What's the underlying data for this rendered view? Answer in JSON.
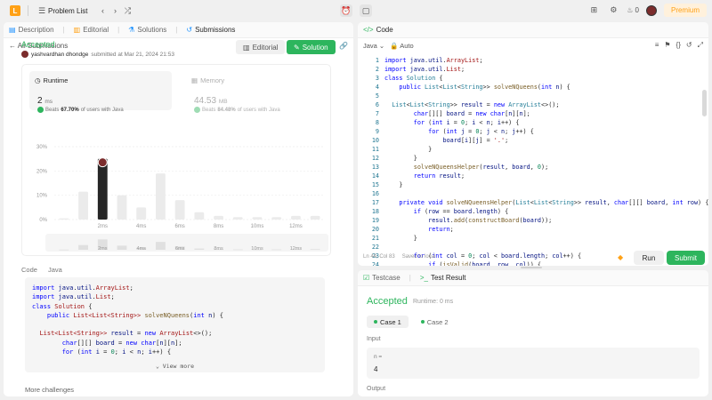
{
  "topbar": {
    "title": "Problem List",
    "fire_count": "0",
    "premium": "Premium"
  },
  "left": {
    "tabs": [
      {
        "label": "Description",
        "icon": "doc-icon"
      },
      {
        "label": "Editorial",
        "icon": "book-icon"
      },
      {
        "label": "Solutions",
        "icon": "flask-icon"
      },
      {
        "label": "Submissions",
        "icon": "history-icon"
      }
    ],
    "back_label": "All Submissions",
    "status": "Accepted",
    "author": "yashvardhan dhondge",
    "submitted_on": "submitted at Mar 21, 2024 21:53",
    "editorial_btn": "Editorial",
    "solution_btn": "Solution",
    "runtime": {
      "label": "Runtime",
      "value": "2",
      "unit": "ms",
      "beats_prefix": "Beats",
      "beats_pct": "67.70%",
      "beats_suffix": "of users with Java"
    },
    "memory": {
      "label": "Memory",
      "value": "44.53",
      "unit": "MB",
      "beats_prefix": "Beats",
      "beats_pct": "84.48%",
      "beats_suffix": "of users with Java"
    },
    "code_label": "Code",
    "code_lang": "Java",
    "code_lines": [
      "import java.util.ArrayList;",
      "import java.util.List;",
      "class Solution {",
      "    public List<List<String>> solveNQueens(int n) {",
      "",
      "  List<List<String>> result = new ArrayList<>();",
      "        char[][] board = new char[n][n];",
      "        for (int i = 0; i < n; i++) {"
    ],
    "view_more": "View more",
    "more_challenges": "More challenges"
  },
  "chart_data": {
    "type": "bar",
    "title": "",
    "xlabel": "",
    "ylabel": "",
    "y_ticks": [
      "30%",
      "20%",
      "10%",
      "0%"
    ],
    "ylim": [
      0,
      30
    ],
    "x_tick_labels": [
      "2ms",
      "4ms",
      "6ms",
      "8ms",
      "10ms",
      "12ms"
    ],
    "x_tick_positions": [
      2,
      4,
      6,
      8,
      10,
      12
    ],
    "bins": [
      0,
      1,
      2,
      3,
      4,
      5,
      6,
      7,
      8,
      9,
      10,
      11,
      12,
      13
    ],
    "values": [
      0.5,
      11.5,
      25,
      10,
      5,
      19,
      8,
      3,
      1.5,
      1,
      1,
      1,
      1.5,
      1.5
    ],
    "highlight_bin": 2,
    "grid": true,
    "minimap_x_tick_labels": [
      "2ms",
      "4ms",
      "6ms",
      "8ms",
      "10ms",
      "12ms"
    ]
  },
  "editor": {
    "header": "Code",
    "language": "Java",
    "mode": "Auto",
    "line_numbers": [
      "1",
      "2",
      "3",
      "4",
      "5",
      "6",
      "7",
      "8",
      "9",
      "10",
      "11",
      "12",
      "13",
      "14",
      "15",
      "16",
      "17",
      "18",
      "19",
      "20",
      "21",
      "22",
      "23",
      "24",
      "25",
      "26"
    ],
    "status": "Ln 44, Col 83",
    "saved": "Saved to local",
    "run": "Run",
    "submit": "Submit"
  },
  "result": {
    "tab_testcase": "Testcase",
    "tab_result": "Test Result",
    "status": "Accepted",
    "runtime": "Runtime: 0 ms",
    "cases": [
      "Case 1",
      "Case 2"
    ],
    "input_label": "Input",
    "input_name": "n =",
    "input_value": "4",
    "output_label": "Output"
  }
}
